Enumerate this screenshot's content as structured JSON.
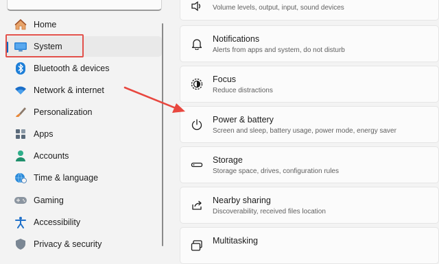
{
  "sidebar": {
    "items": [
      {
        "label": "Home",
        "icon": "home-icon"
      },
      {
        "label": "System",
        "icon": "system-display-icon",
        "selected": true
      },
      {
        "label": "Bluetooth & devices",
        "icon": "bluetooth-icon"
      },
      {
        "label": "Network & internet",
        "icon": "wifi-icon"
      },
      {
        "label": "Personalization",
        "icon": "brush-icon"
      },
      {
        "label": "Apps",
        "icon": "apps-icon"
      },
      {
        "label": "Accounts",
        "icon": "accounts-icon"
      },
      {
        "label": "Time & language",
        "icon": "globe-clock-icon"
      },
      {
        "label": "Gaming",
        "icon": "gamepad-icon"
      },
      {
        "label": "Accessibility",
        "icon": "accessibility-icon"
      },
      {
        "label": "Privacy & security",
        "icon": "shield-icon"
      }
    ]
  },
  "main": {
    "cards": [
      {
        "title": "",
        "desc": "Volume levels, output, input, sound devices",
        "icon": "speaker-icon"
      },
      {
        "title": "Notifications",
        "desc": "Alerts from apps and system, do not disturb",
        "icon": "bell-icon"
      },
      {
        "title": "Focus",
        "desc": "Reduce distractions",
        "icon": "focus-icon"
      },
      {
        "title": "Power & battery",
        "desc": "Screen and sleep, battery usage, power mode, energy saver",
        "icon": "power-icon"
      },
      {
        "title": "Storage",
        "desc": "Storage space, drives, configuration rules",
        "icon": "storage-icon"
      },
      {
        "title": "Nearby sharing",
        "desc": "Discoverability, received files location",
        "icon": "share-icon"
      },
      {
        "title": "Multitasking",
        "desc": "",
        "icon": "multitasking-icon"
      }
    ]
  },
  "colors": {
    "accent": "#0067c0",
    "annotation": "#e2504a"
  }
}
